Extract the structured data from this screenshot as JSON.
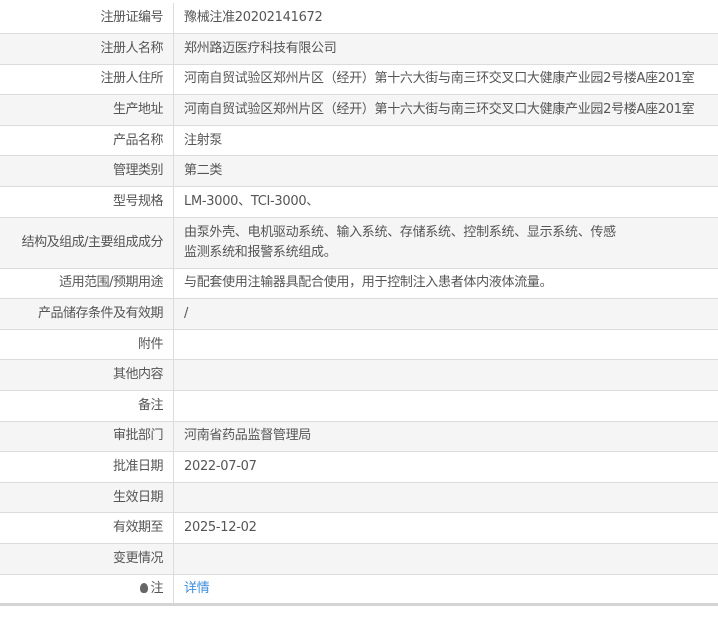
{
  "rows": [
    {
      "label": "注册证编号",
      "value": "豫械注准20202141672"
    },
    {
      "label": "注册人名称",
      "value": "郑州路迈医疗科技有限公司"
    },
    {
      "label": "注册人住所",
      "value": "河南自贸试验区郑州片区（经开）第十六大街与南三环交叉口大健康产业园2号楼A座201室"
    },
    {
      "label": "生产地址",
      "value": "河南自贸试验区郑州片区（经开）第十六大街与南三环交叉口大健康产业园2号楼A座201室"
    },
    {
      "label": "产品名称",
      "value": "注射泵"
    },
    {
      "label": "管理类别",
      "value": "第二类"
    },
    {
      "label": "型号规格",
      "value": "LM-3000、TCI-3000、"
    },
    {
      "label": "结构及组成/主要组成成分",
      "value": "由泵外壳、电机驱动系统、输入系统、存储系统、控制系统、显示系统、传感",
      "value2": "监测系统和报警系统组成。"
    },
    {
      "label": "适用范围/预期用途",
      "value": "与配套使用注输器具配合使用，用于控制注入患者体内液体流量。"
    },
    {
      "label": "产品储存条件及有效期",
      "value": "/"
    },
    {
      "label": "附件",
      "value": ""
    },
    {
      "label": "其他内容",
      "value": ""
    },
    {
      "label": "备注",
      "value": ""
    },
    {
      "label": "审批部门",
      "value": "河南省药品监督管理局"
    },
    {
      "label": "批准日期",
      "value": "2022-07-07"
    },
    {
      "label": "生效日期",
      "value": ""
    },
    {
      "label": "有效期至",
      "value": "2025-12-02"
    },
    {
      "label": "变更情况",
      "value": ""
    },
    {
      "label": "注",
      "value": "详情"
    }
  ]
}
